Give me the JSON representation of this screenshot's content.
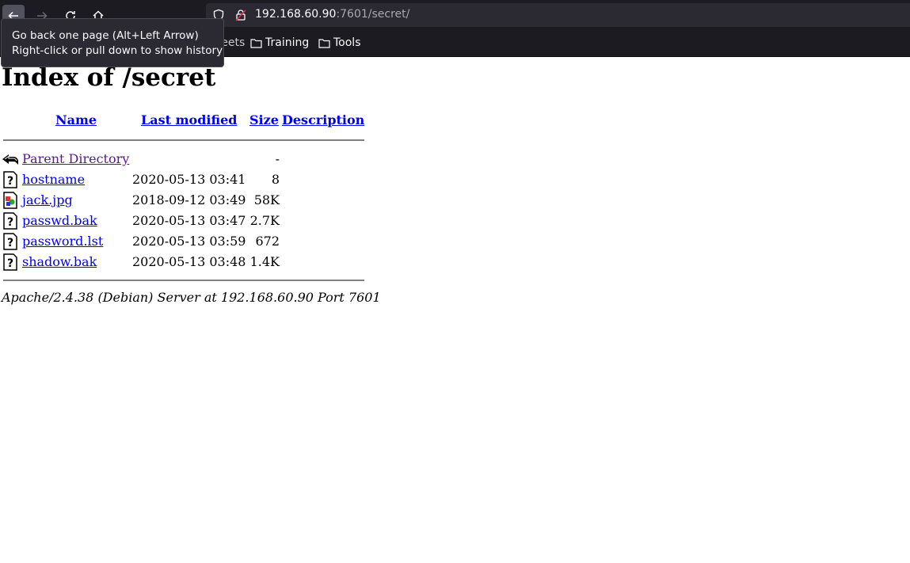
{
  "browser": {
    "url_host": "192.168.60.90",
    "url_path": ":7601/secret/",
    "bookmarks": [
      {
        "label": "eat sheets"
      },
      {
        "label": "Training"
      },
      {
        "label": "Tools"
      }
    ],
    "tooltip": {
      "line1": "Go back one page (Alt+Left Arrow)",
      "line2": "Right-click or pull down to show history"
    }
  },
  "page": {
    "title": "Index of /secret",
    "columns": {
      "name": "Name",
      "last_modified": "Last modified",
      "size": "Size",
      "description": "Description"
    },
    "rows": [
      {
        "name": "Parent Directory",
        "date": "",
        "size": "-",
        "icon": "back-arrow-icon"
      },
      {
        "name": "hostname",
        "date": "2020-05-13 03:41",
        "size": "8",
        "icon": "unknown-file-icon"
      },
      {
        "name": "jack.jpg",
        "date": "2018-09-12 03:49",
        "size": "58K",
        "icon": "image-file-icon"
      },
      {
        "name": "passwd.bak",
        "date": "2020-05-13 03:47",
        "size": "2.7K",
        "icon": "unknown-file-icon"
      },
      {
        "name": "password.lst",
        "date": "2020-05-13 03:59",
        "size": "672",
        "icon": "unknown-file-icon"
      },
      {
        "name": "shadow.bak",
        "date": "2020-05-13 03:48",
        "size": "1.4K",
        "icon": "unknown-file-icon"
      }
    ],
    "footer": "Apache/2.4.38 (Debian) Server at 192.168.60.90 Port 7601"
  }
}
